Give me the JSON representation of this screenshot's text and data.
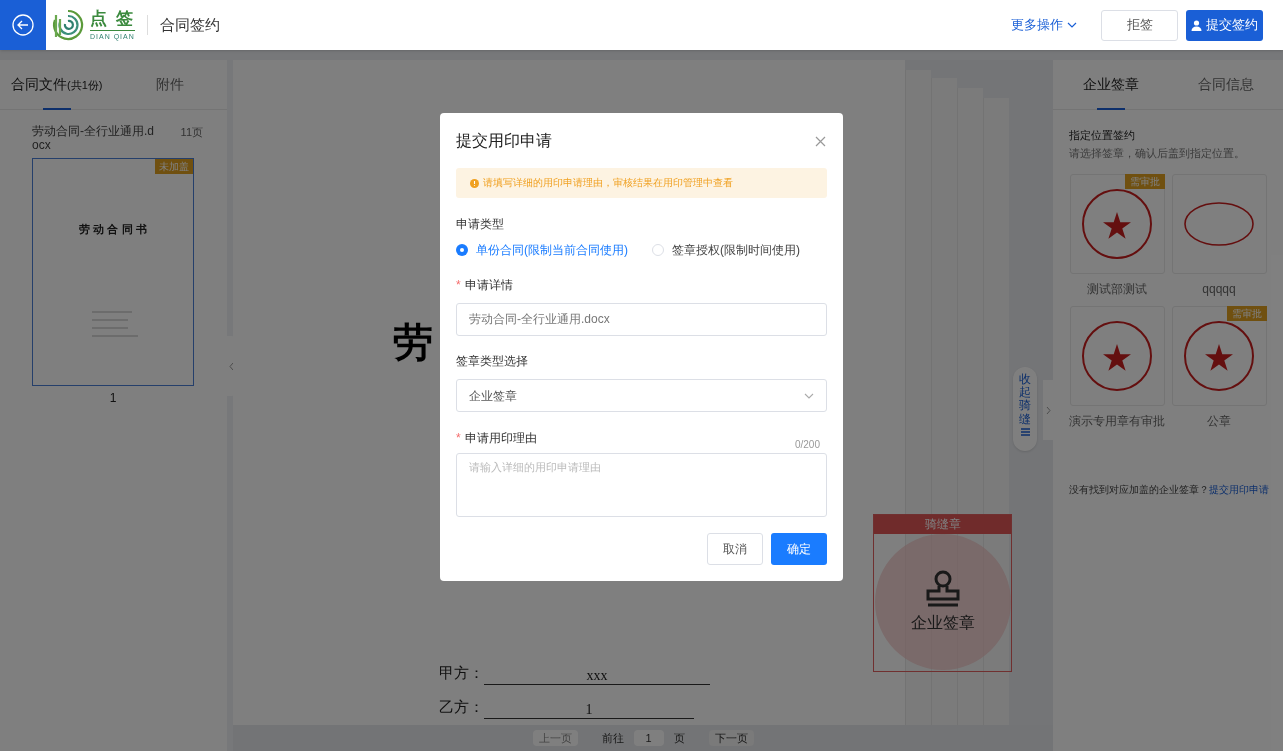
{
  "header": {
    "logo_text": "点 签",
    "logo_sub": "DIAN QIAN",
    "title": "合同签约",
    "more_actions": "更多操作",
    "reject_button": "拒签",
    "submit_button": "提交签约"
  },
  "left_panel": {
    "tabs": [
      {
        "label": "合同文件",
        "suffix": "(共1份)",
        "selected": true
      },
      {
        "label": "附件",
        "selected": false
      }
    ],
    "file": {
      "name": "劳动合同-全行业通用.docx",
      "pages": "11页",
      "thumbnail_title": "劳 动 合 同 书",
      "badge": "未加盖",
      "page_number": "1"
    }
  },
  "document": {
    "title_fragment": "劳",
    "party_lines": [
      {
        "label": "甲方：",
        "value": "xxx"
      },
      {
        "label": "乙方：",
        "value": "1"
      }
    ],
    "seam_tab": "收起骑缝",
    "seam_stamp": {
      "header": "骑缝章",
      "label": "企业签章"
    }
  },
  "pagination": {
    "prev": "上一页",
    "prev_disabled": true,
    "goto": "前往",
    "page": "1",
    "page_unit": "页",
    "next": "下一页"
  },
  "right_panel": {
    "tabs": [
      {
        "label": "企业签章",
        "selected": true
      },
      {
        "label": "合同信息",
        "selected": false
      }
    ],
    "section_title": "指定位置签约",
    "section_hint": "请选择签章，确认后盖到指定位置。",
    "seals": [
      {
        "name": "测试部测试",
        "kind": "round",
        "badge": "需审批"
      },
      {
        "name": "qqqqq",
        "kind": "oval"
      },
      {
        "name": "演示专用章有审批",
        "kind": "round"
      },
      {
        "name": "公章",
        "kind": "round",
        "badge": "需审批"
      }
    ],
    "footer_text": "没有找到对应加盖的企业签章？",
    "footer_link": "提交用印申请"
  },
  "dialog": {
    "title": "提交用印申请",
    "notice": "请填写详细的用印申请理由，审核结果在用印管理中查看",
    "type_label": "申请类型",
    "type_options": [
      {
        "label": "单份合同(限制当前合同使用)",
        "selected": true
      },
      {
        "label": "签章授权(限制时间使用)",
        "selected": false
      }
    ],
    "detail_label": "申请详情",
    "detail_required_mark": "*",
    "detail_value": "劳动合同-全行业通用.docx",
    "seal_type_label": "签章类型选择",
    "seal_type_value": "企业签章",
    "reason_label": "申请用印理由",
    "reason_required_mark": "*",
    "reason_counter": "0/200",
    "reason_placeholder": "请输入详细的用印申请理由",
    "cancel_button": "取消",
    "confirm_button": "确定"
  }
}
